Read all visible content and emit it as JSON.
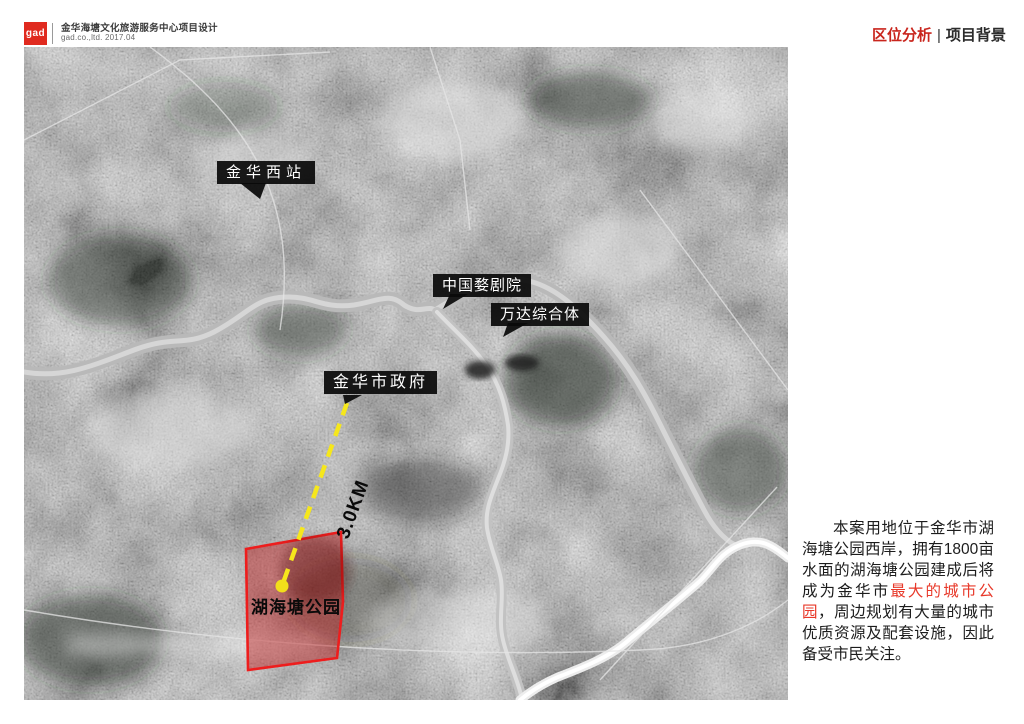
{
  "slide": {
    "header": {
      "logo": "gad",
      "project_title": "金华海塘文化旅游服务中心项目设计",
      "company_line": "gad.co.,ltd. 2017.04",
      "section_primary": "区位分析",
      "section_separator": "|",
      "section_secondary": "项目背景"
    },
    "map": {
      "labels": {
        "west_station": "金华西站",
        "opera_house": "中国婺剧院",
        "wanda_complex": "万达综合体",
        "city_government": "金华市政府",
        "park": "湖海塘公园",
        "distance": "3.0KM"
      }
    },
    "description": {
      "lead_in": "本案用地位于金华市湖海塘公园西岸，拥有1800亩水面的湖海塘公园建成后将成为金华市",
      "highlight": "最大的城市公园",
      "tail": "，周边规划有大量的城市优质资源及配套设施，因此备受市民关注。"
    },
    "colors": {
      "brand_red": "#e02a1f",
      "site_outline": "#ee1d1d",
      "route_yellow": "#f6e71b",
      "highlight_red": "#e8392a"
    }
  }
}
